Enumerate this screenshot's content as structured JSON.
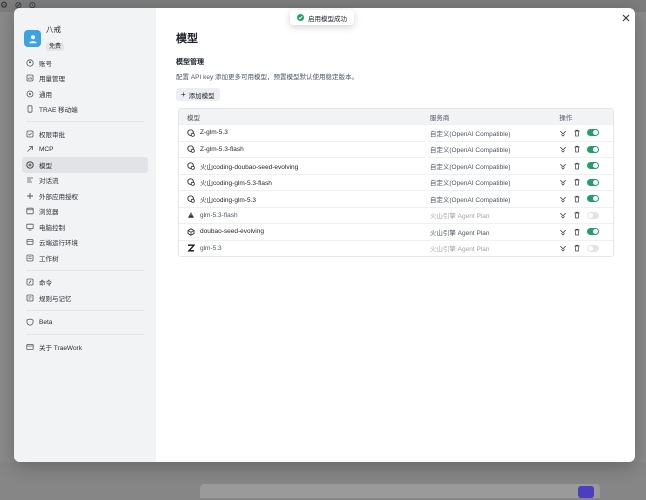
{
  "background": {
    "top_icons": "⚙ ⊘ ⊙"
  },
  "user": {
    "name": "八戒",
    "plan": "免费"
  },
  "sidebar": {
    "groups": [
      [
        {
          "label": "账号",
          "icon": "account-icon"
        },
        {
          "label": "用量管理",
          "icon": "usage-icon"
        },
        {
          "label": "通用",
          "icon": "general-icon"
        },
        {
          "label": "TRAE 移动端",
          "icon": "mobile-icon"
        }
      ],
      [
        {
          "label": "权限审批",
          "icon": "permission-icon"
        },
        {
          "label": "MCP",
          "icon": "mcp-icon"
        },
        {
          "label": "模型",
          "icon": "model-icon",
          "active": true
        },
        {
          "label": "对话流",
          "icon": "flow-icon"
        },
        {
          "label": "外部应用授权",
          "icon": "external-app-icon"
        },
        {
          "label": "浏览器",
          "icon": "browser-icon"
        },
        {
          "label": "电脑控制",
          "icon": "computer-icon"
        },
        {
          "label": "云端运行环境",
          "icon": "cloud-icon"
        },
        {
          "label": "工作树",
          "icon": "worktree-icon"
        }
      ],
      [
        {
          "label": "命令",
          "icon": "command-icon"
        },
        {
          "label": "规则与记忆",
          "icon": "rules-icon"
        }
      ],
      [
        {
          "label": "Beta",
          "icon": "beta-icon"
        }
      ],
      [
        {
          "label": "关于 TraeWork",
          "icon": "about-icon"
        }
      ]
    ]
  },
  "main": {
    "title": "模型",
    "section_title": "模型管理",
    "section_desc": "配置 API key 添加更多可用模型，预置模型默认使用稳定版本。",
    "add_button": "添加模型",
    "table": {
      "headers": {
        "model": "模型",
        "provider": "服务商",
        "ops": "操作"
      },
      "rows": [
        {
          "name": "Z-glm-5.3",
          "provider": "自定义(OpenAI Compatible)",
          "enabled": true,
          "icon": "custom-model-icon"
        },
        {
          "name": "Z-glm-5.3-flash",
          "provider": "自定义(OpenAI Compatible)",
          "enabled": true,
          "icon": "custom-model-icon"
        },
        {
          "name": "火山coding-doubao-seed-evolving",
          "provider": "自定义(OpenAI Compatible)",
          "enabled": true,
          "icon": "custom-model-icon"
        },
        {
          "name": "火山coding-glm-5.3-flash",
          "provider": "自定义(OpenAI Compatible)",
          "enabled": true,
          "icon": "custom-model-icon"
        },
        {
          "name": "火山coding-glm-5.3",
          "provider": "自定义(OpenAI Compatible)",
          "enabled": true,
          "icon": "custom-model-icon"
        },
        {
          "name": "glm-5.3-flash",
          "provider": "火山引擎 Agent Plan",
          "enabled": false,
          "icon": "volcano-model-icon"
        },
        {
          "name": "doubao-seed-evolving",
          "provider": "火山引擎 Agent Plan",
          "enabled": true,
          "icon": "doubao-model-icon"
        },
        {
          "name": "glm-5.3",
          "provider": "火山引擎 Agent Plan",
          "enabled": false,
          "icon": "zhipu-model-icon"
        }
      ]
    }
  },
  "toast": {
    "text": "启用模型成功"
  },
  "close_icon": "close-icon",
  "colors": {
    "toggle_on": "#22a06b",
    "avatar": "#3aa3e3",
    "accent": "#4b3fbf"
  }
}
